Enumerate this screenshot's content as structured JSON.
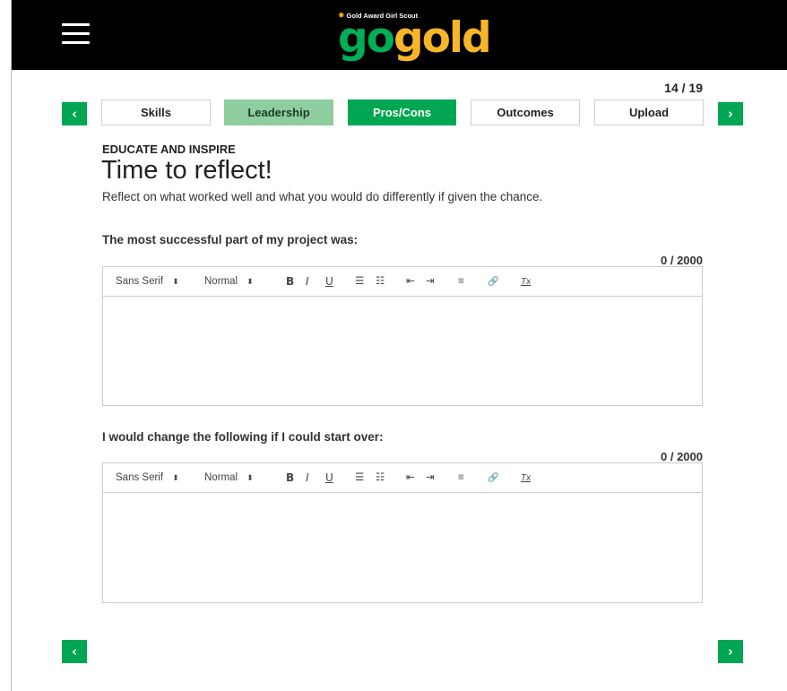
{
  "header": {
    "logo_tagline": "Gold Award Girl Scout",
    "logo_go": "go",
    "logo_gold": "gold"
  },
  "progress": {
    "label": "14 / 19",
    "current": 14,
    "total": 19
  },
  "tabs": [
    {
      "label": "Skills",
      "state": "default"
    },
    {
      "label": "Leadership",
      "state": "done"
    },
    {
      "label": "Pros/Cons",
      "state": "active"
    },
    {
      "label": "Outcomes",
      "state": "default"
    },
    {
      "label": "Upload",
      "state": "default"
    }
  ],
  "nav": {
    "prev_icon": "‹",
    "next_icon": "›"
  },
  "section": {
    "kicker": "EDUCATE AND INSPIRE",
    "title": "Time to reflect!",
    "intro": "Reflect on what worked well and what you would do differently if given the chance."
  },
  "toolbar": {
    "font": "Sans Serif",
    "size": "Normal",
    "bold": "B",
    "italic": "I",
    "underline": "U",
    "ordered_list_icon": "☰",
    "bullet_list_icon": "☷",
    "outdent_icon": "⇤",
    "indent_icon": "⇥",
    "align_icon": "≡",
    "link_icon": "🔗",
    "clean_icon": "Tx",
    "arrow": "⬍"
  },
  "questions": [
    {
      "label": "The most successful part of my project was:",
      "count": "0 / 2000",
      "value": ""
    },
    {
      "label": "I would change the following if I could start over:",
      "count": "0 / 2000",
      "value": ""
    }
  ],
  "colors": {
    "brand_green": "#00a651",
    "tab_done": "#8dcd9e",
    "logo_gold": "#f7b52a",
    "topbar": "#000000"
  }
}
